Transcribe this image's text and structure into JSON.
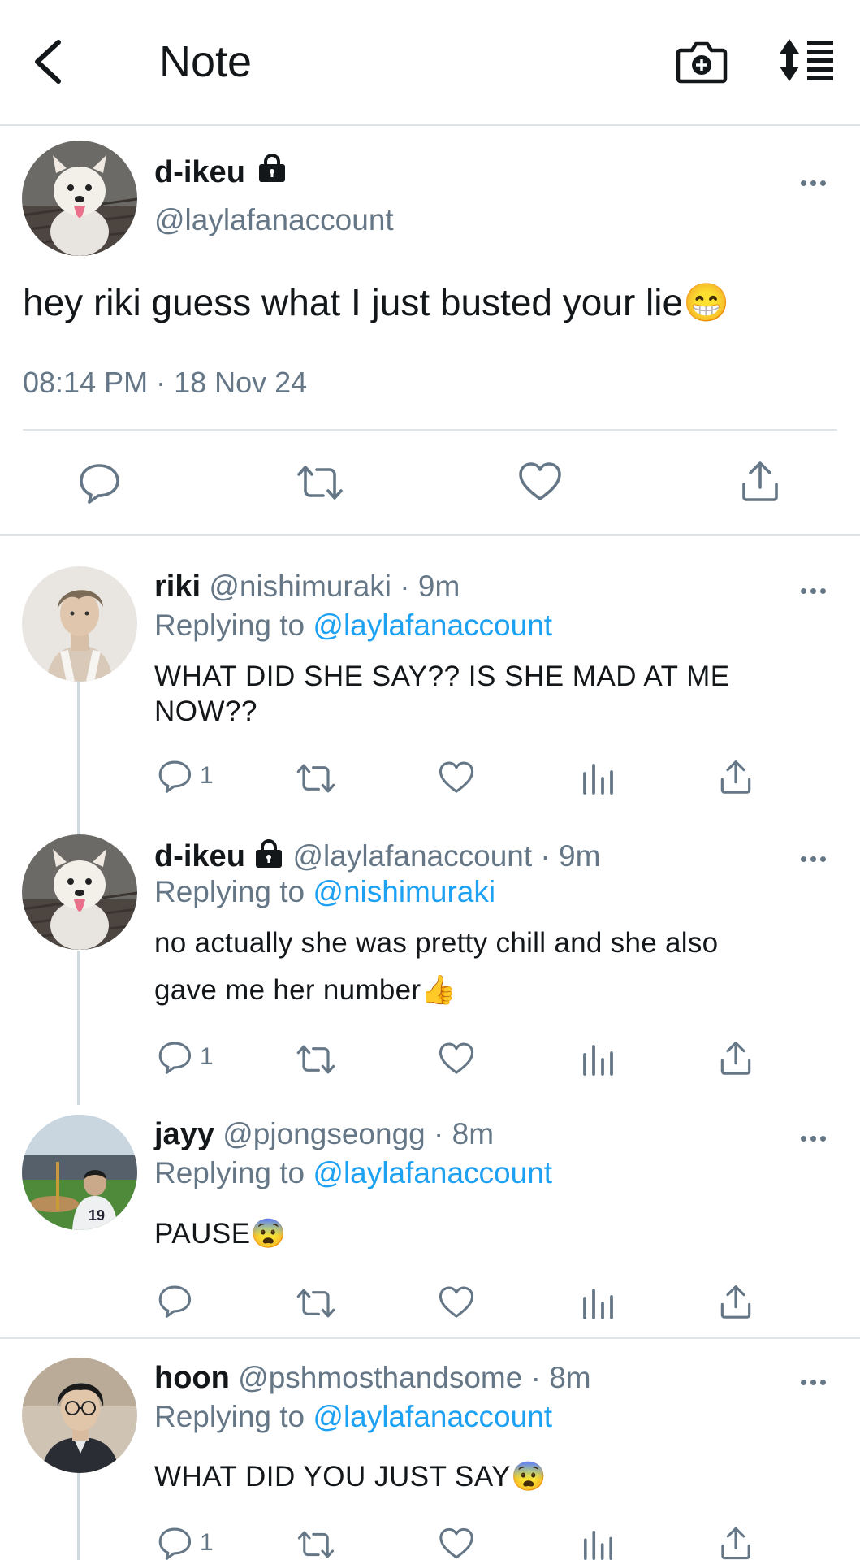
{
  "header": {
    "title": "Note"
  },
  "icons": {
    "back": "chevron-left-icon",
    "camera": "camera-plus-icon",
    "sort": "sort-list-icon",
    "lock": "lock-icon",
    "more": "more-horizontal-icon",
    "reply": "reply-icon",
    "retweet": "retweet-icon",
    "like": "heart-icon",
    "analytics": "analytics-icon",
    "share": "share-icon"
  },
  "colors": {
    "link": "#1da1f2",
    "muted": "#657786",
    "text": "#14171a",
    "divider": "#e1e4e6"
  },
  "main_tweet": {
    "name": "d-ikeu",
    "handle": "@laylafanaccount",
    "text": "hey riki guess what I just busted your lie",
    "emoji": "😁",
    "timestamp": "08:14 PM · 18 Nov 24"
  },
  "replies": [
    {
      "name": "riki",
      "handle": "@nishimuraki · 9m",
      "replying_prefix": "Replying to",
      "replying_to": "@laylafanaccount",
      "text_lines": [
        "WHAT DID SHE SAY?? IS SHE MAD AT ME",
        "NOW??"
      ],
      "reply_count": "1"
    },
    {
      "name": "d-ikeu",
      "handle": "@laylafanaccount · 9m",
      "replying_prefix": "Replying to",
      "replying_to": "@nishimuraki",
      "text_lines": [
        "no actually she was pretty chill and she also",
        "gave me her number"
      ],
      "emoji": "👍",
      "reply_count": "1"
    },
    {
      "name": "jayy",
      "handle": "@pjongseongg · 8m",
      "replying_prefix": "Replying to",
      "replying_to": "@laylafanaccount",
      "text": "PAUSE",
      "emoji": "😨",
      "reply_count": ""
    },
    {
      "name": "hoon",
      "handle": "@pshmosthandsome · 8m",
      "replying_prefix": "Replying to",
      "replying_to": "@laylafanaccount",
      "text": "WHAT DID YOU JUST SAY",
      "emoji": "😨",
      "reply_count": "1"
    }
  ]
}
